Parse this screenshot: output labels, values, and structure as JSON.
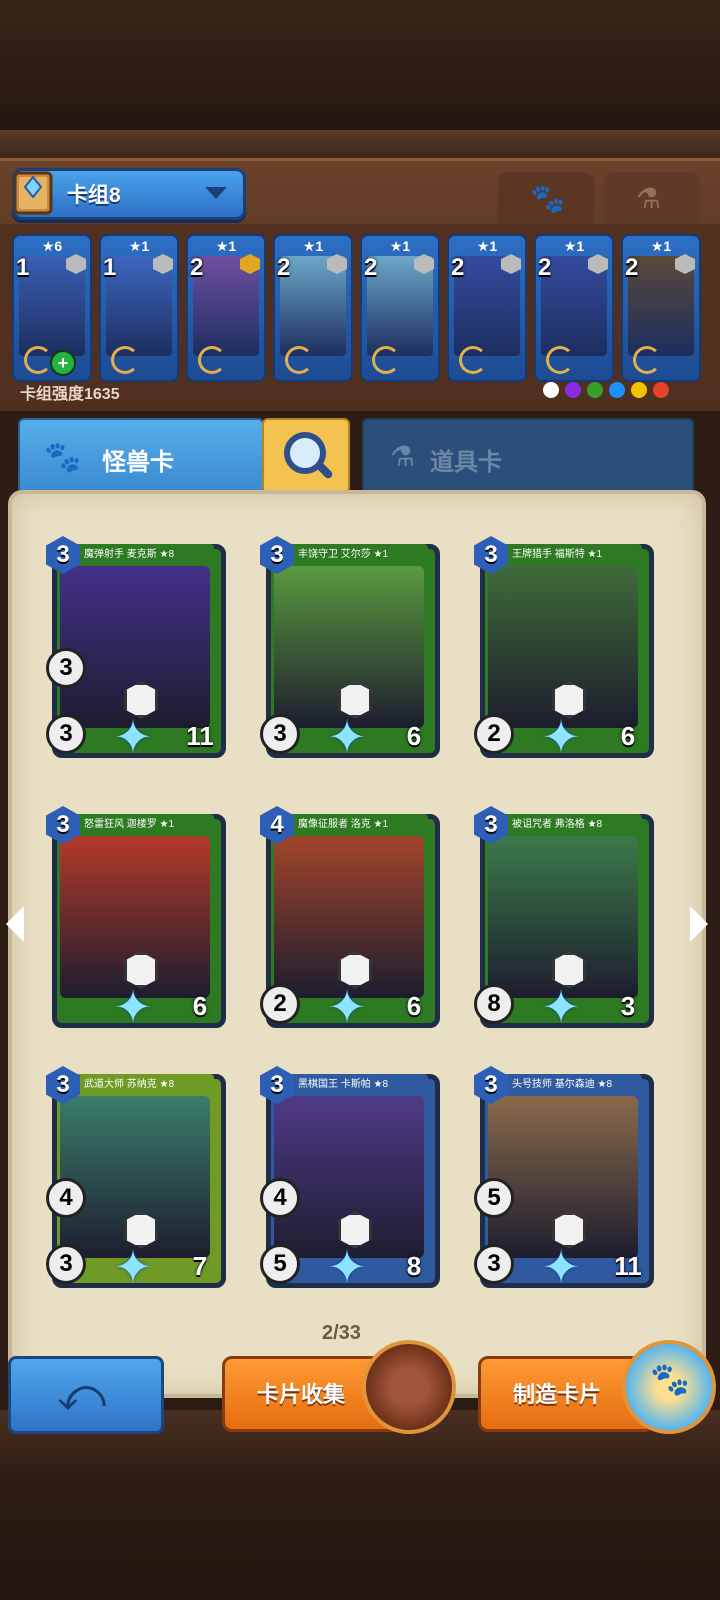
{
  "deck": {
    "name": "卡组8",
    "strength_label": "卡组强度1635",
    "cards": [
      {
        "stars": "★6",
        "count": "1",
        "gem": "silver",
        "art": "#3b5fb3",
        "has_plus": true
      },
      {
        "stars": "★1",
        "count": "1",
        "gem": "silver",
        "art": "#3d67c0",
        "has_plus": false
      },
      {
        "stars": "★1",
        "count": "2",
        "gem": "gold",
        "art": "#6f4fa3",
        "has_plus": false
      },
      {
        "stars": "★1",
        "count": "2",
        "gem": "silver",
        "art": "#6ca7c8",
        "has_plus": false
      },
      {
        "stars": "★1",
        "count": "2",
        "gem": "silver",
        "art": "#6ca7c8",
        "has_plus": false
      },
      {
        "stars": "★1",
        "count": "2",
        "gem": "silver",
        "art": "#354b9f",
        "has_plus": false
      },
      {
        "stars": "★1",
        "count": "2",
        "gem": "silver",
        "art": "#354b9f",
        "has_plus": false
      },
      {
        "stars": "★1",
        "count": "2",
        "gem": "silver",
        "art": "#59493a",
        "has_plus": false
      }
    ],
    "elements": [
      "#ffffff",
      "#8a2be2",
      "#33a02c",
      "#1e90ff",
      "#f2c300",
      "#e2432a"
    ]
  },
  "tabs": {
    "monster_label": "怪兽卡",
    "item_label": "道具卡"
  },
  "cards": [
    {
      "name": "魔弹射手 麦克斯 ★8",
      "cost": "3",
      "mid": "3",
      "atk": "3",
      "hp": "11",
      "art": "#44308a",
      "bar": "#2d7a22"
    },
    {
      "name": "丰饶守卫 艾尔莎 ★1",
      "cost": "3",
      "mid": "",
      "atk": "3",
      "hp": "6",
      "art": "#5a9a3f",
      "bar": "#2d7a22"
    },
    {
      "name": "王牌猎手 福斯特 ★1",
      "cost": "3",
      "mid": "",
      "atk": "2",
      "hp": "6",
      "art": "#3f6a3a",
      "bar": "#2d7a22"
    },
    {
      "name": "怒雷狂风 迦楼罗 ★1",
      "cost": "3",
      "mid": "",
      "atk": "",
      "hp": "6",
      "art": "#b33a2a",
      "bar": "#2d7a22"
    },
    {
      "name": "魔像征服者 洛克 ★1",
      "cost": "4",
      "mid": "",
      "atk": "2",
      "hp": "6",
      "art": "#a2452c",
      "bar": "#2d7a22"
    },
    {
      "name": "被诅咒者 弗洛格 ★8",
      "cost": "3",
      "mid": "",
      "atk": "8",
      "hp": "3",
      "art": "#3b7a4a",
      "bar": "#2d7a22"
    },
    {
      "name": "武道大师 苏纳克 ★8",
      "cost": "3",
      "mid": "4",
      "atk": "3",
      "hp": "7",
      "art": "#3a7d6b",
      "bar": "#6f9a26"
    },
    {
      "name": "黑棋国王 卡斯帕 ★8",
      "cost": "3",
      "mid": "4",
      "atk": "5",
      "hp": "8",
      "art": "#503a88",
      "bar": "#2f5aa0"
    },
    {
      "name": "头号技师 基尔森迪 ★8",
      "cost": "3",
      "mid": "5",
      "atk": "3",
      "hp": "11",
      "art": "#8a6a4a",
      "bar": "#2f5aa0"
    }
  ],
  "pagination": {
    "label": "2/33"
  },
  "buttons": {
    "collect_label": "卡片收集",
    "craft_label": "制造卡片"
  }
}
